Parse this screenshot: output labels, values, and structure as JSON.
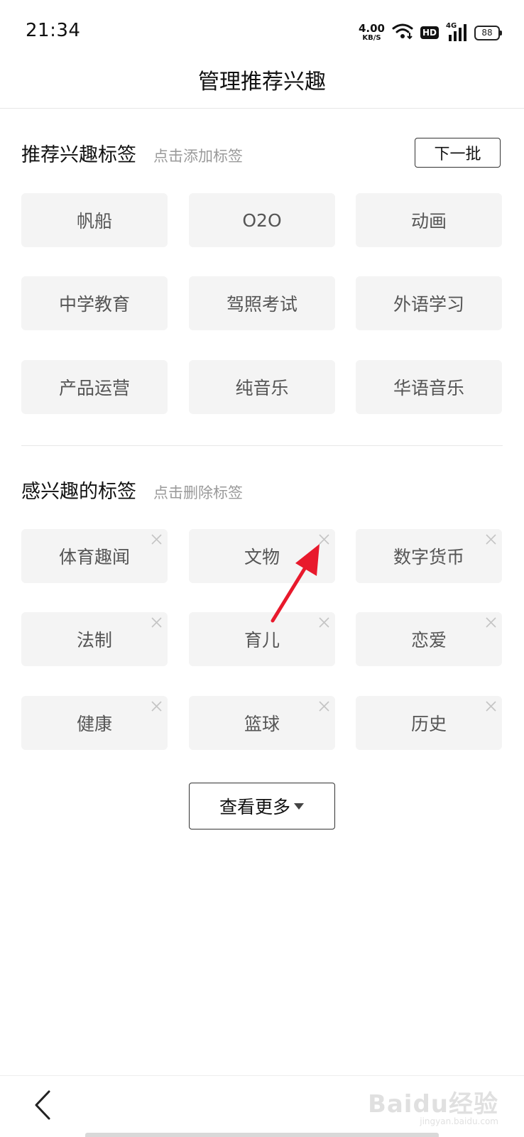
{
  "status_bar": {
    "time": "21:34",
    "net_speed_value": "4.00",
    "net_speed_unit": "KB/S",
    "hd_label": "HD",
    "network_label": "4G",
    "battery": "88"
  },
  "header": {
    "title": "管理推荐兴趣"
  },
  "recommended": {
    "title": "推荐兴趣标签",
    "hint": "点击添加标签",
    "next_batch_label": "下一批",
    "tags": [
      "帆船",
      "O2O",
      "动画",
      "中学教育",
      "驾照考试",
      "外语学习",
      "产品运营",
      "纯音乐",
      "华语音乐"
    ]
  },
  "interested": {
    "title": "感兴趣的标签",
    "hint": "点击删除标签",
    "tags": [
      "体育趣闻",
      "文物",
      "数字货币",
      "法制",
      "育儿",
      "恋爱",
      "健康",
      "篮球",
      "历史"
    ]
  },
  "see_more_label": "查看更多",
  "icons": {
    "close": "close-icon",
    "dropdown": "caret-down-icon",
    "back": "chevron-left-icon",
    "wifi": "wifi-icon",
    "signal": "signal-icon"
  },
  "colors": {
    "annotation_arrow": "#e8192c",
    "tag_bg": "#f4f4f4",
    "hint_text": "#9a9a9a"
  },
  "watermark": {
    "brand": "Baidu经验",
    "site": "jingyan.baidu.com"
  }
}
